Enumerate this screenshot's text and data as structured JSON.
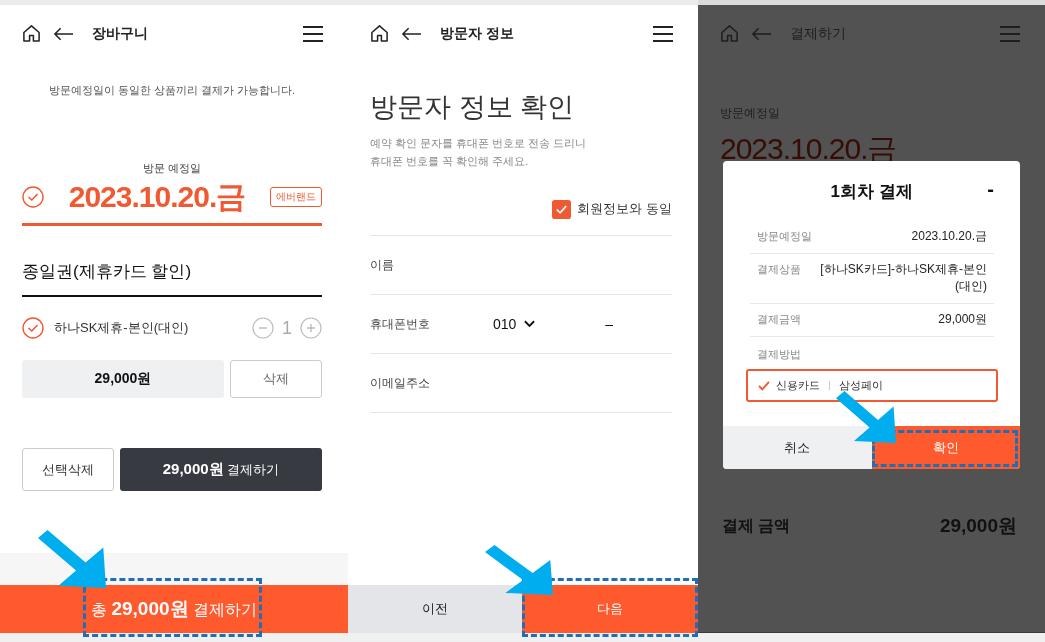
{
  "screens": [
    {
      "kind": "cart",
      "header": {
        "title": "장바구니"
      },
      "notice": "방문예정일이 동일한 상품끼리 결제가 가능합니다.",
      "visit": {
        "label": "방문 예정일",
        "date": "2023.10.20.금",
        "checked": true,
        "badge": "에버랜드"
      },
      "section_title": "종일권(제휴카드 할인)",
      "items": [
        {
          "name": "하나SK제휴-본인(대인)",
          "checked": true,
          "quantity": "1",
          "price": "29,000원",
          "delete_label": "삭제"
        }
      ],
      "actions": {
        "delete_selected": "선택삭제",
        "pay": "**29,000원** 결제하기"
      },
      "bottom_button": {
        "label": "총 **29,000원** 결제하기",
        "highlighted": true
      }
    },
    {
      "kind": "visitor",
      "header": {
        "title": "방문자 정보"
      },
      "title": "방문자 정보 확인",
      "description": [
        "예약 확인 문자를 휴대폰 번호로 전송 드리니",
        "휴대폰 번호를 꼭 확인해 주세요."
      ],
      "same_as_member": {
        "label": "회원정보와 동일",
        "checked": true
      },
      "fields": [
        {
          "kind": "text",
          "label": "이름"
        },
        {
          "kind": "phone",
          "label": "휴대폰번호",
          "prefix": "010",
          "separator": "–"
        },
        {
          "kind": "text",
          "label": "이메일주소"
        }
      ],
      "buttons": [
        {
          "label": "이전",
          "kind": "secondary",
          "highlighted": false
        },
        {
          "label": "다음",
          "kind": "primary",
          "highlighted": true
        }
      ]
    },
    {
      "kind": "payment",
      "header": {
        "title": "결제하기"
      },
      "dimmed": true,
      "visit": {
        "label": "방문예정일",
        "date": "2023.10.20.금"
      },
      "total": {
        "label": "결제 금액",
        "amount": "29,000원"
      },
      "dialog": {
        "title": "1회차 결제",
        "collapse": "-",
        "rows": [
          {
            "label": "방문예정일",
            "value": "2023.10.20.금"
          },
          {
            "label": "결제상품",
            "value": "[하나SK카드]-하나SK제휴-본인 (대인)"
          },
          {
            "label": "결제금액",
            "value": "29,000원"
          }
        ],
        "method_label": "결제방법",
        "methods": [
          {
            "label": "신용카드",
            "selected": true
          },
          {
            "label": "삼성페이",
            "selected": false
          }
        ],
        "buttons": [
          {
            "label": "취소",
            "kind": "secondary",
            "highlighted": false
          },
          {
            "label": "확인",
            "kind": "primary",
            "highlighted": true
          }
        ]
      }
    }
  ]
}
